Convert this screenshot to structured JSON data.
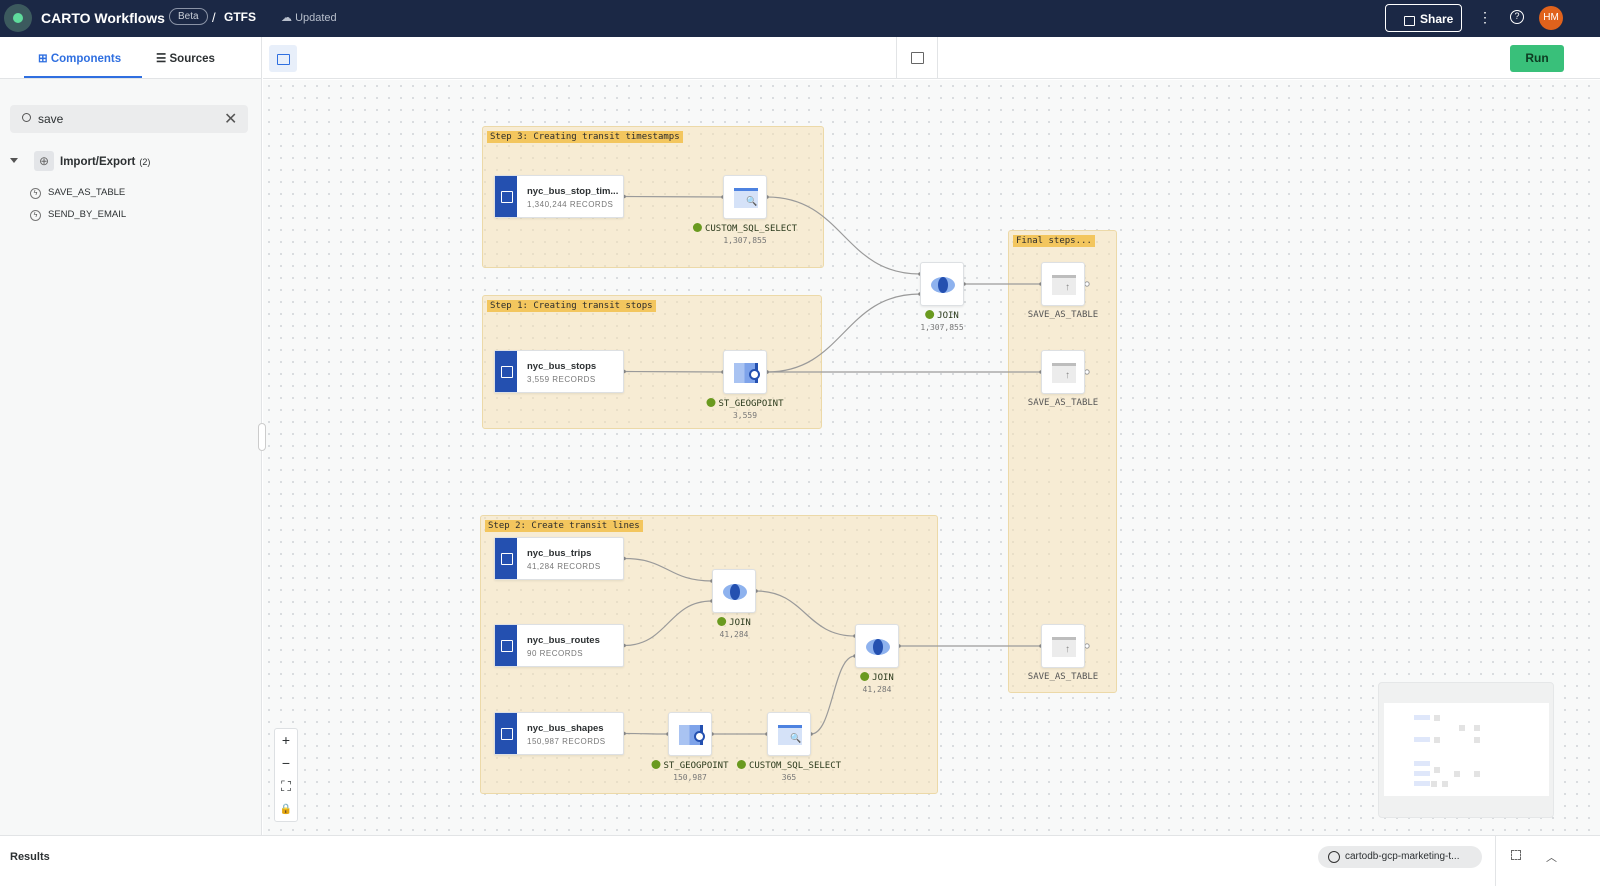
{
  "header": {
    "app_title": "CARTO Workflows",
    "beta_badge": "Beta",
    "separator": "/",
    "workflow_name": "GTFS",
    "status": "Updated",
    "share_label": "Share",
    "more_icon": "kebab-icon",
    "help_icon": "help-icon",
    "avatar_initials": "HM"
  },
  "sidebar": {
    "tabs": [
      {
        "label": "Components",
        "active": true
      },
      {
        "label": "Sources",
        "active": false
      }
    ],
    "search": {
      "value": "save",
      "placeholder": "Search"
    },
    "category": {
      "label": "Import/Export",
      "count": "(2)",
      "items": [
        {
          "label": "SAVE_AS_TABLE"
        },
        {
          "label": "SEND_BY_EMAIL"
        }
      ]
    }
  },
  "toolbar": {
    "run_label": "Run"
  },
  "canvas": {
    "groups": [
      {
        "id": "step3",
        "title": "Step 3: Creating transit timestamps"
      },
      {
        "id": "step1",
        "title": "Step 1: Creating transit stops"
      },
      {
        "id": "step2",
        "title": "Step 2: Create transit lines"
      },
      {
        "id": "final",
        "title": "Final steps..."
      }
    ],
    "sources": [
      {
        "id": "stop_times",
        "name": "nyc_bus_stop_tim...",
        "records": "1,340,244 RECORDS"
      },
      {
        "id": "stops",
        "name": "nyc_bus_stops",
        "records": "3,559 RECORDS"
      },
      {
        "id": "trips",
        "name": "nyc_bus_trips",
        "records": "41,284 RECORDS"
      },
      {
        "id": "routes",
        "name": "nyc_bus_routes",
        "records": "90 RECORDS"
      },
      {
        "id": "shapes",
        "name": "nyc_bus_shapes",
        "records": "150,987 RECORDS"
      }
    ],
    "components": [
      {
        "id": "sql1",
        "type": "sql",
        "label": "CUSTOM_SQL_SELECT",
        "count": "1,307,855",
        "status": "success"
      },
      {
        "id": "geo1",
        "type": "geo",
        "label": "ST_GEOGPOINT",
        "count": "3,559",
        "status": "success"
      },
      {
        "id": "join1",
        "type": "join",
        "label": "JOIN",
        "count": "1,307,855",
        "status": "success"
      },
      {
        "id": "save1",
        "type": "save",
        "label": "SAVE_AS_TABLE",
        "count": "",
        "status": "pending"
      },
      {
        "id": "save2",
        "type": "save",
        "label": "SAVE_AS_TABLE",
        "count": "",
        "status": "pending"
      },
      {
        "id": "join2",
        "type": "join",
        "label": "JOIN",
        "count": "41,284",
        "status": "success"
      },
      {
        "id": "join3",
        "type": "join",
        "label": "JOIN",
        "count": "41,284",
        "status": "success"
      },
      {
        "id": "geo2",
        "type": "geo",
        "label": "ST_GEOGPOINT",
        "count": "150,987",
        "status": "success"
      },
      {
        "id": "sql2",
        "type": "sql",
        "label": "CUSTOM_SQL_SELECT",
        "count": "365",
        "status": "success"
      },
      {
        "id": "save3",
        "type": "save",
        "label": "SAVE_AS_TABLE",
        "count": "",
        "status": "pending"
      }
    ],
    "edges": [
      [
        "stop_times",
        "sql1"
      ],
      [
        "sql1",
        "join1"
      ],
      [
        "stops",
        "geo1"
      ],
      [
        "geo1",
        "join1"
      ],
      [
        "geo1",
        "save2"
      ],
      [
        "join1",
        "save1"
      ],
      [
        "trips",
        "join2"
      ],
      [
        "routes",
        "join2"
      ],
      [
        "join2",
        "join3"
      ],
      [
        "shapes",
        "geo2"
      ],
      [
        "geo2",
        "sql2"
      ],
      [
        "sql2",
        "join3"
      ],
      [
        "join3",
        "save3"
      ]
    ],
    "colors": {
      "accent": "#2f6fe0",
      "source": "#2450b0",
      "success": "#6a9a1f",
      "group_title": "#f3c65e",
      "run": "#39c07a",
      "header": "#1b2845"
    }
  },
  "results": {
    "title": "Results",
    "connection": "cartodb-gcp-marketing-t..."
  }
}
